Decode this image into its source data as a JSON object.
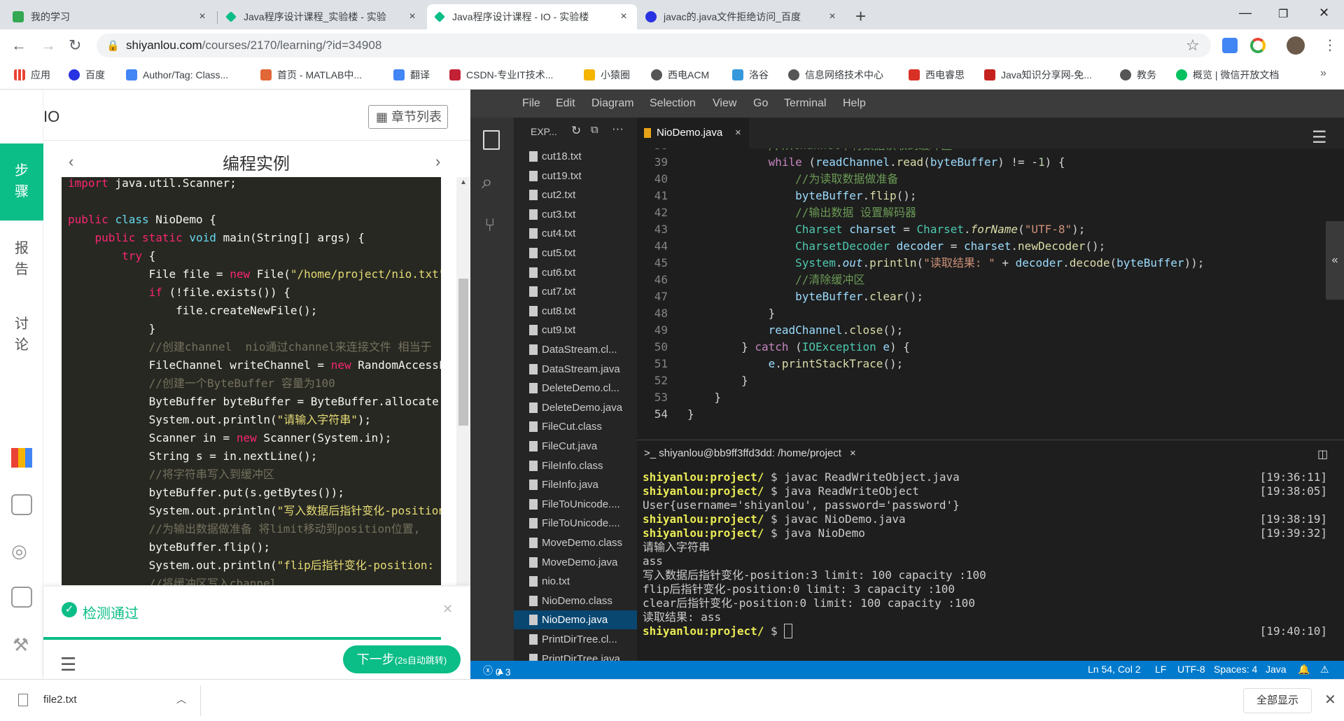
{
  "browser": {
    "tabs": [
      {
        "title": "我的学习",
        "color": "#34a853"
      },
      {
        "title": "Java程序设计课程_实验楼 - 实验",
        "color": "#0bbd87"
      },
      {
        "title": "Java程序设计课程 - IO - 实验楼",
        "color": "#0bbd87"
      },
      {
        "title": "javac的.java文件拒绝访问_百度",
        "color": "#2932e1"
      }
    ],
    "url_host": "shiyanlou.com",
    "url_path": "/courses/2170/learning/?id=34908",
    "bookmarks": [
      {
        "label": "应用",
        "color": "#ea4335"
      },
      {
        "label": "百度",
        "color": "#2932e1"
      },
      {
        "label": "Author/Tag: Class...",
        "color": "#4285f4"
      },
      {
        "label": "首页 - MATLAB中...",
        "color": "#e16737"
      },
      {
        "label": "翻译",
        "color": "#4285f4"
      },
      {
        "label": "CSDN-专业IT技术...",
        "color": "#c32136"
      },
      {
        "label": "小猿圈",
        "color": "#f4b400"
      },
      {
        "label": "西电ACM",
        "color": "#555555"
      },
      {
        "label": "洛谷",
        "color": "#3498db"
      },
      {
        "label": "信息网络技术中心",
        "color": "#555555"
      },
      {
        "label": "西电睿思",
        "color": "#d93025"
      },
      {
        "label": "Java知识分享网-免...",
        "color": "#c5221f"
      },
      {
        "label": "教务",
        "color": "#555555"
      },
      {
        "label": "概览 | 微信开放文档",
        "color": "#07c160"
      }
    ]
  },
  "course": {
    "title": "IO",
    "chapter_list_label": "章节列表",
    "section_title": "编程实例",
    "nav": {
      "steps": "步骤",
      "report": "报告",
      "discuss": "讨论"
    },
    "pass_text": "检测通过",
    "next_button": "下一步",
    "next_hint": "(2s自动跳转)"
  },
  "vscode": {
    "menu": [
      "File",
      "Edit",
      "Diagram",
      "Selection",
      "View",
      "Go",
      "Terminal",
      "Help"
    ],
    "explorer_title": "EXP...",
    "files": [
      "cut18.txt",
      "cut19.txt",
      "cut2.txt",
      "cut3.txt",
      "cut4.txt",
      "cut5.txt",
      "cut6.txt",
      "cut7.txt",
      "cut8.txt",
      "cut9.txt",
      "DataStream.cl...",
      "DataStream.java",
      "DeleteDemo.cl...",
      "DeleteDemo.java",
      "FileCut.class",
      "FileCut.java",
      "FileInfo.class",
      "FileInfo.java",
      "FileToUnicode....",
      "FileToUnicode....",
      "MoveDemo.class",
      "MoveDemo.java",
      "nio.txt",
      "NioDemo.class",
      "NioDemo.java",
      "PrintDirTree.cl...",
      "PrintDirTree.java"
    ],
    "selected_file": "NioDemo.java",
    "editor_tab": "NioDemo.java",
    "terminal_title": "shiyanlou@bb9ff3ffd3dd: /home/project",
    "status": {
      "errors": "0",
      "warnings": "3",
      "position": "Ln 54, Col 2",
      "eol": "LF",
      "encoding": "UTF-8",
      "spaces": "Spaces: 4",
      "language": "Java"
    }
  },
  "download": {
    "file": "file2.txt",
    "show_all": "全部显示"
  }
}
